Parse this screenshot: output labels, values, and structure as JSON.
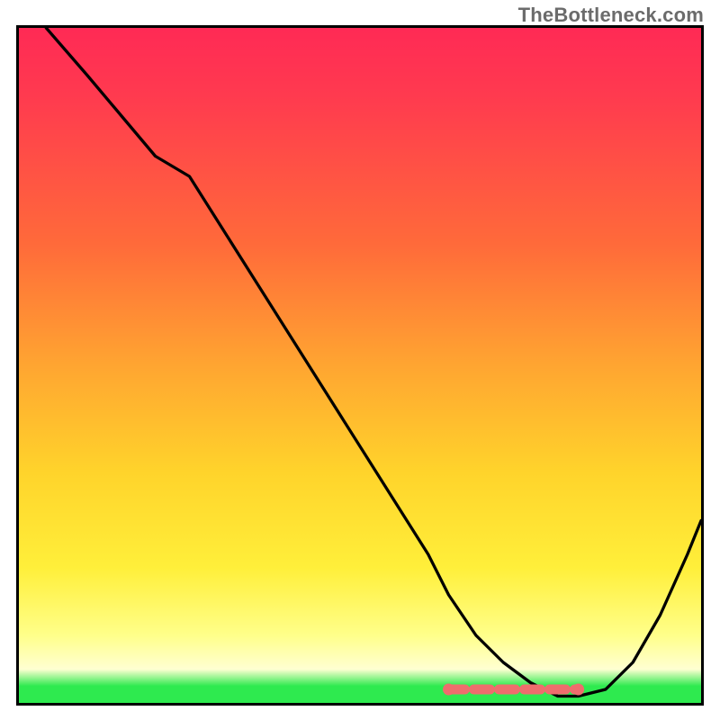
{
  "watermark": "TheBottleneck.com",
  "chart_data": {
    "type": "line",
    "title": "",
    "xlabel": "",
    "ylabel": "",
    "xlim": [
      0,
      100
    ],
    "ylim": [
      0,
      100
    ],
    "grid": false,
    "legend": false,
    "gradient_stops": [
      {
        "pos": 0.0,
        "color": "#ff2a55"
      },
      {
        "pos": 0.1,
        "color": "#ff3a4f"
      },
      {
        "pos": 0.32,
        "color": "#ff6a3a"
      },
      {
        "pos": 0.5,
        "color": "#ffa531"
      },
      {
        "pos": 0.66,
        "color": "#ffd42b"
      },
      {
        "pos": 0.8,
        "color": "#ffef3a"
      },
      {
        "pos": 0.9,
        "color": "#ffff8a"
      },
      {
        "pos": 0.95,
        "color": "#ffffd2"
      },
      {
        "pos": 0.975,
        "color": "#2eea4f"
      },
      {
        "pos": 1.0,
        "color": "#2eea4f"
      }
    ],
    "series": [
      {
        "name": "curve",
        "color": "#000000",
        "x": [
          4,
          10,
          15,
          20,
          25,
          30,
          35,
          40,
          45,
          50,
          55,
          60,
          63,
          67,
          71,
          75,
          79,
          82,
          86,
          90,
          94,
          98,
          100
        ],
        "y": [
          100,
          93,
          87,
          81,
          78,
          70,
          62,
          54,
          46,
          38,
          30,
          22,
          16,
          10,
          6,
          3,
          1,
          1,
          2,
          6,
          13,
          22,
          27
        ]
      },
      {
        "name": "flat-marker",
        "color": "#ee6d6d",
        "type": "scatter",
        "x": [
          63,
          66,
          69,
          72,
          75,
          78,
          81,
          82
        ],
        "y": [
          2,
          2,
          2,
          2,
          2,
          2,
          2,
          2
        ]
      }
    ],
    "annotations": []
  }
}
